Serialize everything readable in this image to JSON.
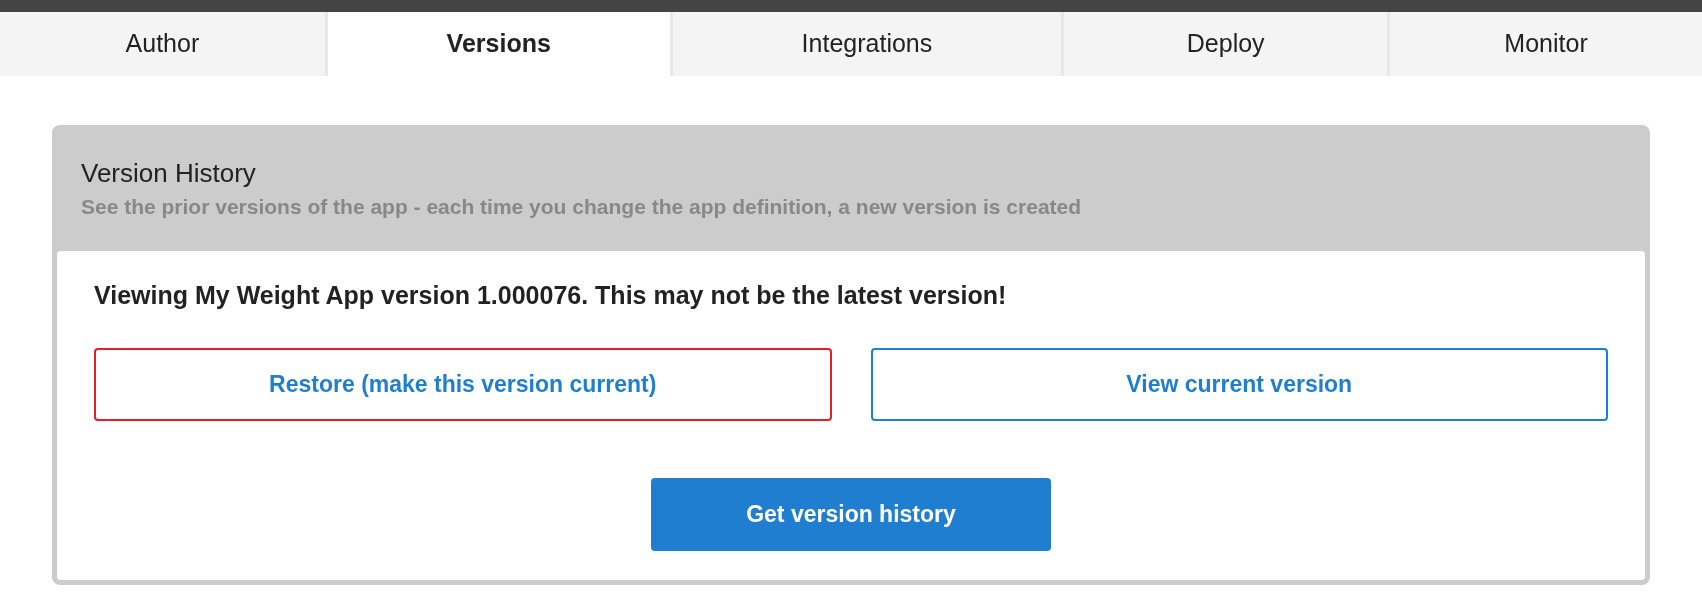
{
  "tabs": [
    {
      "label": "Author",
      "selected": false
    },
    {
      "label": "Versions",
      "selected": true
    },
    {
      "label": "Integrations",
      "selected": false
    },
    {
      "label": "Deploy",
      "selected": false
    },
    {
      "label": "Monitor",
      "selected": false
    }
  ],
  "panel": {
    "title": "Version History",
    "subtitle": "See the prior versions of the app - each time you change the app definition, a new version is created",
    "message": "Viewing My Weight App version 1.000076. This may not be the latest version!",
    "buttons": [
      {
        "label": "Restore (make this version current)",
        "focused": true
      },
      {
        "label": "View current version",
        "focused": false
      }
    ],
    "primary_button": "Get version history"
  }
}
